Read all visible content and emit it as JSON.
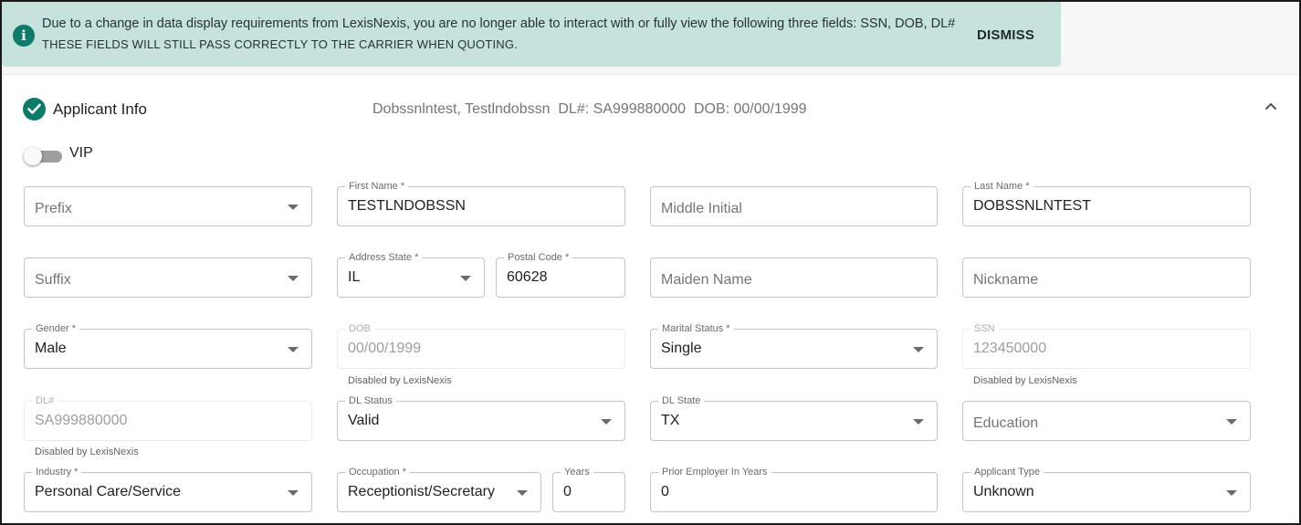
{
  "banner": {
    "icon": "info-icon",
    "message": "Due to a change in data display requirements from LexisNexis, you are no longer able to interact with or fully view the following three fields: SSN, DOB, DL#",
    "note": "THESE FIELDS WILL STILL PASS CORRECTLY TO THE CARRIER WHEN QUOTING.",
    "dismiss_label": "DISMISS",
    "background": "#c6e2dd",
    "accent": "#0d7a6a"
  },
  "section": {
    "title": "Applicant Info",
    "summary": "Dobssnlntest, Testlndobssn  DL#: SA999880000  DOB: 00/00/1999",
    "status_icon": "check-circle-icon",
    "collapse_icon": "chevron-up-icon"
  },
  "vip": {
    "label": "VIP",
    "checked": false
  },
  "fields": {
    "prefix": {
      "placeholder": "Prefix"
    },
    "first_name": {
      "label": "First Name *",
      "value": "TESTLNDOBSSN"
    },
    "middle_initial": {
      "placeholder": "Middle Initial"
    },
    "last_name": {
      "label": "Last Name *",
      "value": "DOBSSNLNTEST"
    },
    "suffix": {
      "placeholder": "Suffix"
    },
    "address_state": {
      "label": "Address State *",
      "value": "IL"
    },
    "postal_code": {
      "label": "Postal Code *",
      "value": "60628"
    },
    "maiden_name": {
      "placeholder": "Maiden Name"
    },
    "nickname": {
      "placeholder": "Nickname"
    },
    "gender": {
      "label": "Gender *",
      "value": "Male"
    },
    "dob": {
      "label": "DOB",
      "value": "00/00/1999",
      "helper": "Disabled by LexisNexis"
    },
    "marital_status": {
      "label": "Marital Status *",
      "value": "Single"
    },
    "ssn": {
      "label": "SSN",
      "value": "123450000",
      "helper": "Disabled by LexisNexis"
    },
    "dl_number": {
      "label": "DL#",
      "value": "SA999880000",
      "helper": "Disabled by LexisNexis"
    },
    "dl_status": {
      "label": "DL Status",
      "value": "Valid"
    },
    "dl_state": {
      "label": "DL State",
      "value": "TX"
    },
    "education": {
      "placeholder": "Education"
    },
    "industry": {
      "label": "Industry *",
      "value": "Personal Care/Service"
    },
    "occupation": {
      "label": "Occupation *",
      "value": "Receptionist/Secretary"
    },
    "years": {
      "label": "Years",
      "value": "0"
    },
    "prior_employer_years": {
      "label": "Prior Employer In Years",
      "value": "0"
    },
    "applicant_type": {
      "label": "Applicant Type",
      "value": "Unknown"
    }
  }
}
